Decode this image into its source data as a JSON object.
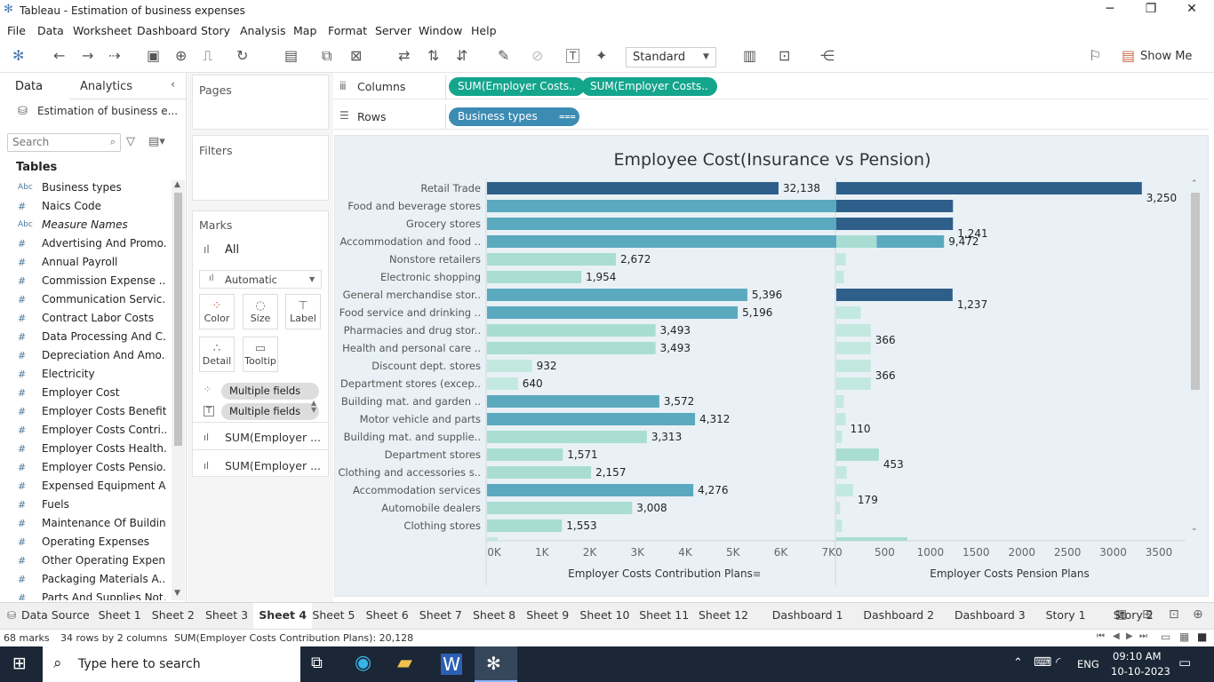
{
  "window": {
    "title": "Tableau - Estimation of business expenses"
  },
  "menu": [
    "File",
    "Data",
    "Worksheet",
    "Dashboard",
    "Story",
    "Analysis",
    "Map",
    "Format",
    "Server",
    "Window",
    "Help"
  ],
  "toolbar": {
    "fit_mode": "Standard",
    "show_me": "Show Me"
  },
  "left_pane": {
    "tab_data": "Data",
    "tab_analytics": "Analytics",
    "datasource": "Estimation of business e...",
    "search_placeholder": "Search",
    "tables_heading": "Tables",
    "fields": [
      {
        "type": "Abc",
        "name": "Business types"
      },
      {
        "type": "#",
        "name": "Naics Code"
      },
      {
        "type": "Abc",
        "name": "Measure Names"
      },
      {
        "type": "#",
        "name": "Advertising And Promo..."
      },
      {
        "type": "#",
        "name": "Annual Payroll"
      },
      {
        "type": "#",
        "name": "Commission Expense ..."
      },
      {
        "type": "#",
        "name": "Communication Servic..."
      },
      {
        "type": "#",
        "name": "Contract Labor Costs"
      },
      {
        "type": "#",
        "name": "Data Processing And C..."
      },
      {
        "type": "#",
        "name": "Depreciation And Amo..."
      },
      {
        "type": "#",
        "name": "Electricity"
      },
      {
        "type": "#",
        "name": "Employer Cost"
      },
      {
        "type": "#",
        "name": "Employer Costs Benefits"
      },
      {
        "type": "#",
        "name": "Employer Costs Contri..."
      },
      {
        "type": "#",
        "name": "Employer Costs Health..."
      },
      {
        "type": "#",
        "name": "Employer Costs Pensio..."
      },
      {
        "type": "#",
        "name": "Expensed Equipment A..."
      },
      {
        "type": "#",
        "name": "Fuels"
      },
      {
        "type": "#",
        "name": "Maintenance Of Buildin..."
      },
      {
        "type": "#",
        "name": "Operating Expenses"
      },
      {
        "type": "#",
        "name": "Other Operating Expen..."
      },
      {
        "type": "#",
        "name": "Packaging Materials A..."
      },
      {
        "type": "#",
        "name": "Parts And Supplies Not..."
      }
    ]
  },
  "cards": {
    "pages": "Pages",
    "filters": "Filters",
    "marks": "Marks",
    "marks_all": "All",
    "mark_type": "Automatic",
    "buttons": [
      "Color",
      "Size",
      "Label",
      "Detail",
      "Tooltip"
    ],
    "mark_fields": [
      "Multiple fields",
      "Multiple fields",
      "SUM(Employer ...",
      "SUM(Employer ..."
    ]
  },
  "shelves": {
    "columns_label": "Columns",
    "rows_label": "Rows",
    "column_pills": [
      "SUM(Employer Costs..",
      "SUM(Employer Costs.."
    ],
    "row_pill": "Business types"
  },
  "chart_data": {
    "type": "bar",
    "title": "Employee Cost(Insurance vs Pension)",
    "categories": [
      "Retail Trade",
      "Food and beverage stores",
      "Grocery stores",
      "Accommodation and food ..",
      "Nonstore retailers",
      "Electronic shopping",
      "General merchandise stor..",
      "Food service and drinking ..",
      "Pharmacies and drug stor..",
      "Health and personal care ..",
      "Discount dept. stores",
      "Department stores (excep..",
      "Building mat. and garden ..",
      "Motor vehicle and parts",
      "Building mat. and supplie..",
      "Department stores",
      "Clothing and accessories s..",
      "Accommodation services",
      "Automobile dealers",
      "Clothing stores"
    ],
    "series": [
      {
        "name": "Employer Costs Contribution Plans",
        "values": [
          32138,
          7688,
          7356,
          9472,
          2672,
          1954,
          5396,
          5196,
          3493,
          3493,
          932,
          640,
          3572,
          4312,
          3313,
          1571,
          2157,
          4276,
          3008,
          1553
        ],
        "xlabel": "Employer Costs Contribution Plans",
        "ticks": [
          "0K",
          "1K",
          "2K",
          "3K",
          "4K",
          "5K",
          "6K",
          "7K"
        ],
        "xlim": [
          0,
          7000
        ]
      },
      {
        "name": "Employer Costs Pension Plans",
        "values": [
          3250,
          1241,
          1241,
          430,
          100,
          80,
          1237,
          260,
          366,
          366,
          366,
          366,
          80,
          100,
          60,
          453,
          110,
          179,
          40,
          60
        ],
        "labels": [
          "3,250",
          "",
          "1,241",
          "",
          "",
          "",
          "1,237",
          "",
          "366",
          "",
          "366",
          "",
          "",
          "110",
          "",
          "453",
          "",
          "179",
          "",
          ""
        ],
        "xlabel": "Employer Costs Pension Plans",
        "ticks": [
          "0",
          "500",
          "1000",
          "1500",
          "2000",
          "2500",
          "3000",
          "3500"
        ],
        "xlim": [
          0,
          3500
        ]
      }
    ],
    "colors": {
      "dark": "#2e5f8a",
      "mid": "#5ba9bf",
      "light": "#a9ddd3",
      "lighter": "#c3e8e0"
    }
  },
  "sheet_tabs": [
    "Data Source",
    "Sheet 1",
    "Sheet 2",
    "Sheet 3",
    "Sheet 4",
    "Sheet 5",
    "Sheet 6",
    "Sheet 7",
    "Sheet 8",
    "Sheet 9",
    "Sheet 10",
    "Sheet 11",
    "Sheet 12",
    "Dashboard 1",
    "Dashboard 2",
    "Dashboard 3",
    "Story 1",
    "Story 2"
  ],
  "active_tab": "Sheet 4",
  "status": {
    "marks": "68 marks",
    "dims": "34 rows by 2 columns",
    "sum": "SUM(Employer Costs Contribution Plans): 20,128"
  },
  "taskbar": {
    "search": "Type here to search",
    "lang": "ENG",
    "time": "09:10 AM",
    "date": "10-10-2023"
  }
}
